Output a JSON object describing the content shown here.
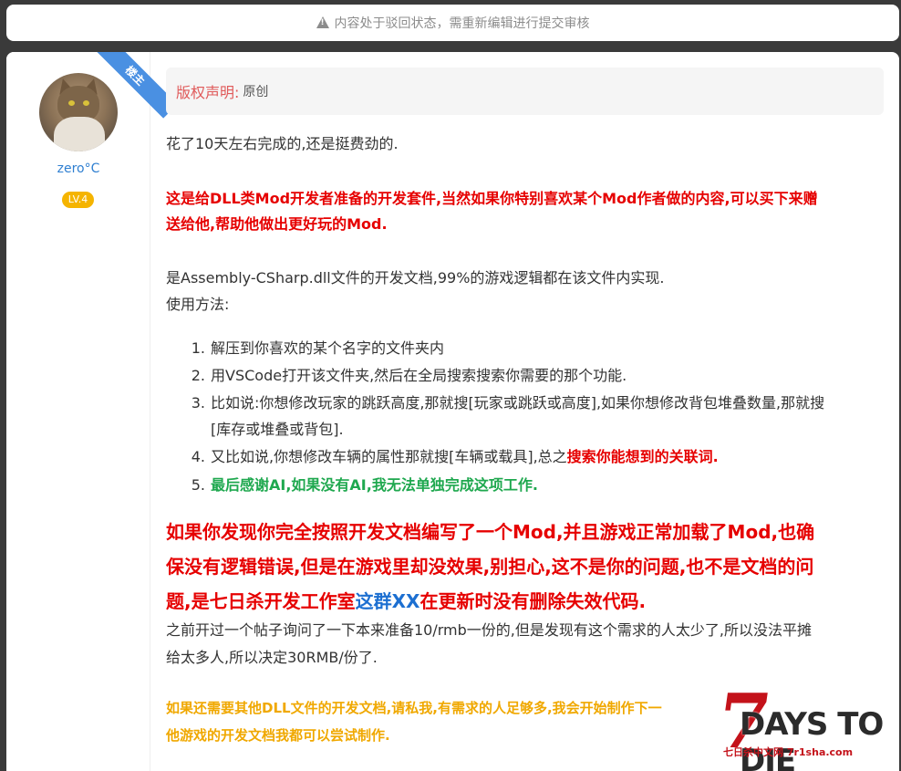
{
  "notice": {
    "icon": "warning-icon",
    "text": "内容处于驳回状态，需重新编辑进行提交审核"
  },
  "author": {
    "ribbon": "楼主",
    "name": "zero°C",
    "level": "LV.4"
  },
  "copyright": {
    "label": "版权声明:",
    "value": "原创"
  },
  "content": {
    "p1": "花了10天左右完成的,还是挺费劲的.",
    "p2a": "这是给DLL类Mod开发者准备的开发套件,当然如果你特别喜欢某个Mod作者做的内容,可以买下来赠",
    "p2b": "送给他,帮助他做出更好玩的Mod.",
    "p3": "是Assembly-CSharp.dll文件的开发文档,99%的游戏逻辑都在该文件内实现.",
    "p4": "使用方法:",
    "steps": [
      {
        "num": "1.",
        "text": "解压到你喜欢的某个名字的文件夹内"
      },
      {
        "num": "2.",
        "text": "用VSCode打开该文件夹,然后在全局搜索搜索你需要的那个功能."
      },
      {
        "num": "3.",
        "text": "比如说:你想修改玩家的跳跃高度,那就搜[玩家或跳跃或高度],如果你想修改背包堆叠数量,那就搜",
        "cont": "[库存或堆叠或背包]."
      },
      {
        "num": "4.",
        "text": "又比如说,你想修改车辆的属性那就搜[车辆或载具],总之",
        "highlight": "搜索你能想到的关联词."
      },
      {
        "num": "5.",
        "text": "最后感谢AI,如果没有AI,我无法单独完成这项工作."
      }
    ],
    "big1": "如果你发现你完全按照开发文档编写了一个Mod,并且游戏正常加载了Mod,也确",
    "big2": "保没有逻辑错误,但是在游戏里却没效果,别担心,这不是你的问题,也不是文档的问",
    "big3a": "题,是七日杀开发工作室",
    "big3b": "这群XX",
    "big3c": "在更新时没有删除失效代码.",
    "p5a": "之前开过一个帖子询问了一下本来准备10/rmb一份的,但是发现有这个需求的人太少了,所以没法平摊",
    "p5b": "给太多人,所以决定30RMB/份了.",
    "p6a": "如果还需要其他DLL文件的开发文档,请私我,有需求的人足够多,我会开始制作下一",
    "p6b": "他游戏的开发文档我都可以尝试制作."
  },
  "watermark": {
    "seven": "7",
    "title": "DAYS TO DIE",
    "sub": "七日杀中文网 7r1sha.com"
  },
  "colors": {
    "red": "#e60000",
    "green": "#1fa84f",
    "orange": "#f0a800",
    "blue": "#1c6fd1",
    "username": "#2f7fd1",
    "level": "#f5b400",
    "ribbon": "#4a90e2"
  }
}
